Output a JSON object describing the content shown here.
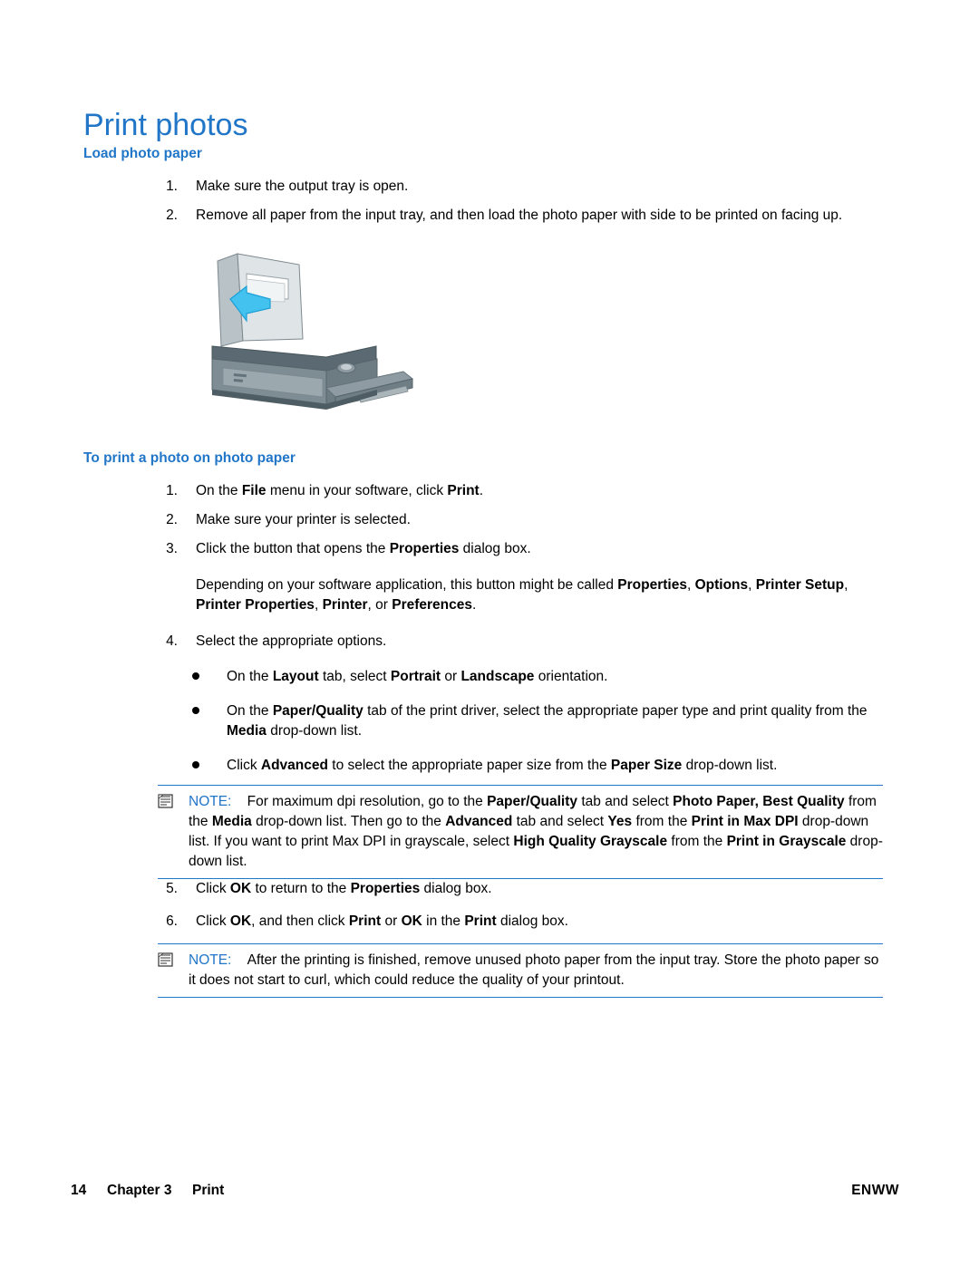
{
  "document": {
    "title": "Print photos",
    "sections": [
      {
        "heading": "Load photo paper"
      },
      {
        "heading": "To print a photo on photo paper"
      }
    ]
  },
  "load_steps": [
    {
      "num": "1.",
      "text": "Make sure the output tray is open."
    },
    {
      "num": "2.",
      "text": "Remove all paper from the input tray, and then load the photo paper with side to be printed on facing up."
    }
  ],
  "print_steps": [
    {
      "num": "1.",
      "html": "On the <b>File</b> menu in your software, click <b>Print</b>."
    },
    {
      "num": "2.",
      "html": "Make sure your printer is selected."
    },
    {
      "num": "3.",
      "html": "Click the button that opens the <b>Properties</b> dialog box."
    },
    {
      "num": "",
      "html": "Depending on your software application, this button might be called <b>Properties</b>, <b>Options</b>, <b>Printer Setup</b>, <b>Printer Properties</b>, <b>Printer</b>, or <b>Preferences</b>."
    },
    {
      "num": "4.",
      "html": "Select the appropriate options."
    }
  ],
  "bullets": [
    {
      "html": "On the <b>Layout</b> tab, select <b>Portrait</b> or <b>Landscape</b> orientation."
    },
    {
      "html": "On the <b>Paper/Quality</b> tab of the print driver, select the appropriate paper type and print quality from the <b>Media</b> drop-down list."
    },
    {
      "html": "Click <b>Advanced</b> to select the appropriate paper size from the <b>Paper Size</b> drop-down list."
    }
  ],
  "note_1": {
    "label": "NOTE:",
    "html": "For maximum dpi resolution, go to the <b>Paper/Quality</b> tab and select <b>Photo Paper, Best Quality</b> from the <b>Media</b> drop-down list. Then go to the <b>Advanced</b> tab and select <b>Yes</b> from the <b>Print in Max DPI</b> drop-down list. If you want to print Max DPI in grayscale, select <b>High Quality Grayscale</b> from the <b>Print in Grayscale</b> drop-down list."
  },
  "print_steps_tail": [
    {
      "num": "5.",
      "html": "Click <b>OK</b> to return to the <b>Properties</b> dialog box."
    },
    {
      "num": "6.",
      "html": "Click <b>OK</b>, and then click <b>Print</b> or <b>OK</b> in the <b>Print</b> dialog box."
    }
  ],
  "note_2": {
    "label": "NOTE:",
    "html": "After the printing is finished, remove unused photo paper from the input tray. Store the photo paper so it does not start to curl, which could reduce the quality of your printout."
  },
  "footer": {
    "page_number": "14",
    "chapter": "Chapter 3",
    "section": "Print",
    "brand": "ENWW"
  },
  "colors": {
    "accent": "#2176c7",
    "text": "#000000",
    "arrow": "#33bbee"
  },
  "figure": {
    "alt": "printer-illustration"
  }
}
